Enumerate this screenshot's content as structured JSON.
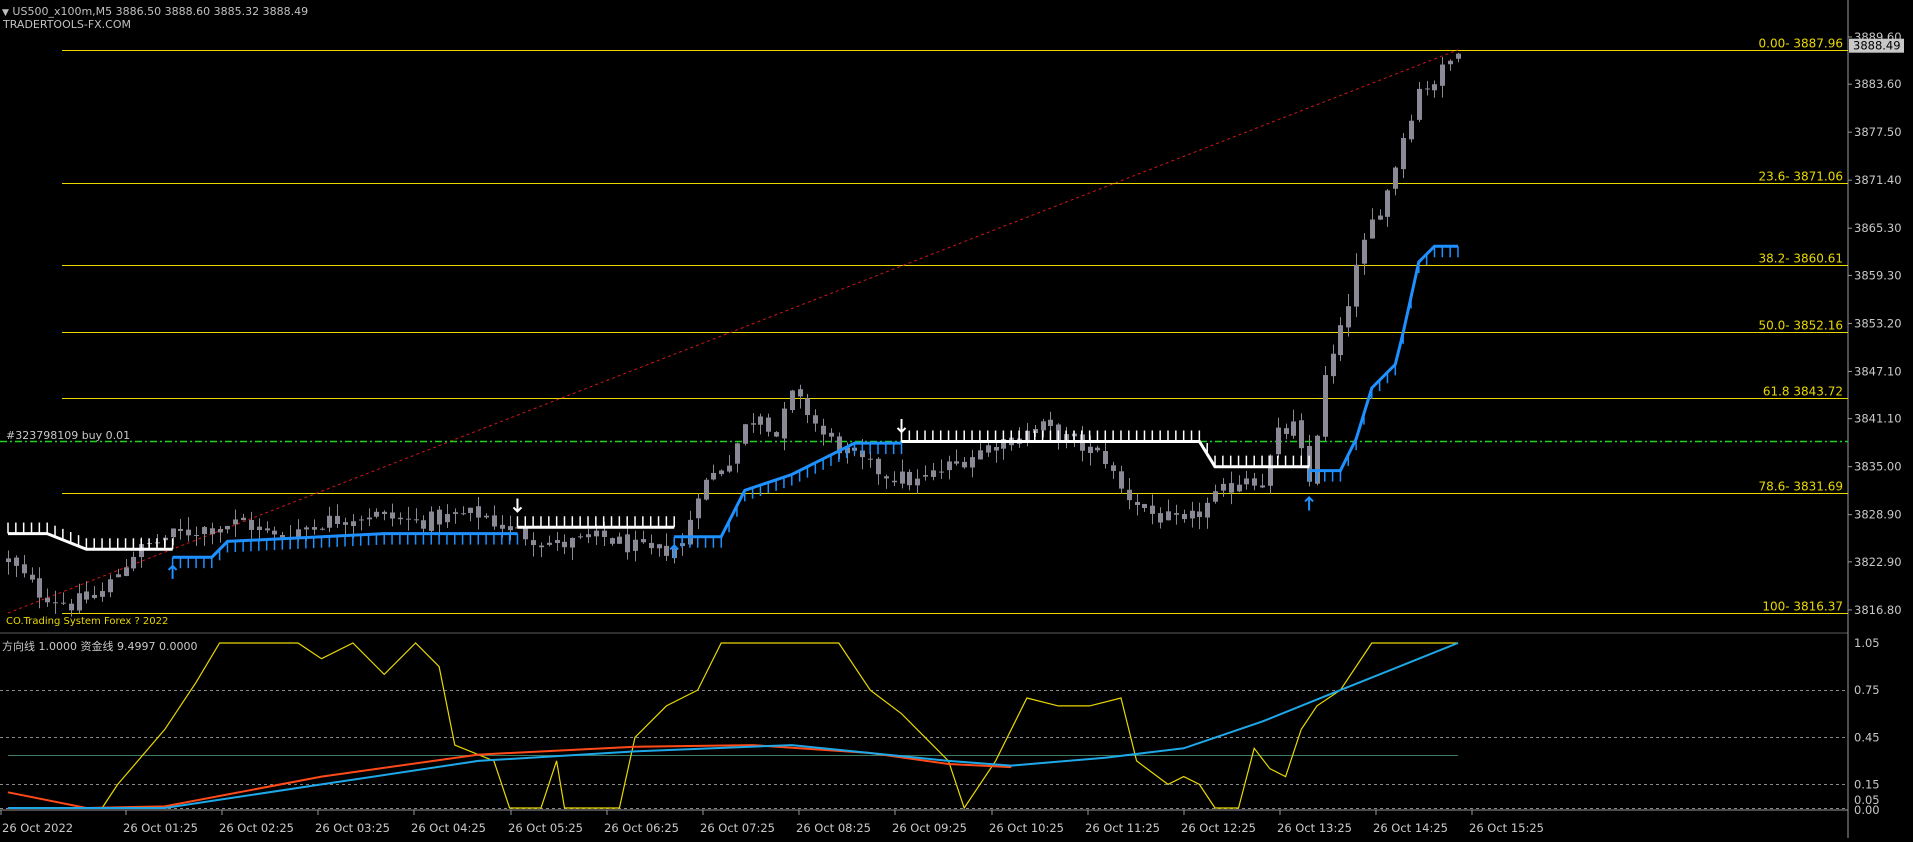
{
  "header": {
    "symbol_line": "US500_x100m,M5  3886.50 3888.60 3885.32 3888.49",
    "watermark": "TRADERTOOLS-FX.COM",
    "order_label": "#323798109 buy 0.01",
    "system_label": "CO.Trading System Forex  ? 2022",
    "indicator_label": "方向线 1.0000  资金线 9.4997 0.0000",
    "current_price": "3888.49"
  },
  "colors": {
    "background": "#000000",
    "candle": "#8a8a96",
    "fib": "#e8d800",
    "trend_line": "#d01818",
    "order_line": "#22d422",
    "stop_white": "#ffffff",
    "stop_blue": "#1e90ff",
    "direction_line": "#e8d800",
    "fund_line_blue": "#1ea8e8",
    "fund_line_red": "#ff4a1a",
    "price_badge": "#c8c8c8"
  },
  "chart_data": [
    {
      "type": "candlestick",
      "name_in_chart": "US500_x100m,M5",
      "ylim": [
        3814.5,
        3891.5
      ],
      "yticks": [
        "3889.60",
        "3883.60",
        "3877.50",
        "3871.40",
        "3865.30",
        "3859.30",
        "3853.20",
        "3847.10",
        "3841.10",
        "3835.00",
        "3828.90",
        "3822.90",
        "3816.80"
      ],
      "xticks": [
        "26 Oct 2022",
        "26 Oct 01:25",
        "26 Oct 02:25",
        "26 Oct 03:25",
        "26 Oct 04:25",
        "26 Oct 05:25",
        "26 Oct 06:25",
        "26 Oct 07:25",
        "26 Oct 08:25",
        "26 Oct 09:25",
        "26 Oct 10:25",
        "26 Oct 11:25",
        "26 Oct 12:25",
        "26 Oct 13:25",
        "26 Oct 14:25",
        "26 Oct 15:25"
      ],
      "fib_levels": [
        {
          "label": "0.00- 3887.96",
          "value": 3887.96
        },
        {
          "label": "23.6- 3871.06",
          "value": 3871.06
        },
        {
          "label": "38.2- 3860.61",
          "value": 3860.61
        },
        {
          "label": "50.0- 3852.16",
          "value": 3852.16
        },
        {
          "label": "61.8 3843.72",
          "value": 3843.72
        },
        {
          "label": "78.6- 3831.69",
          "value": 3831.69
        },
        {
          "label": "100- 3816.37",
          "value": 3816.37
        }
      ],
      "order_level": 3838.2,
      "trend_line": {
        "from": [
          0,
          3816.4
        ],
        "to": [
          185,
          3887.96
        ]
      },
      "price_anchors": [
        [
          0,
          3823
        ],
        [
          4,
          3819
        ],
        [
          8,
          3817.5
        ],
        [
          12,
          3819
        ],
        [
          16,
          3824
        ],
        [
          20,
          3826
        ],
        [
          24,
          3827
        ],
        [
          30,
          3828
        ],
        [
          34,
          3826
        ],
        [
          40,
          3828
        ],
        [
          46,
          3829
        ],
        [
          52,
          3828
        ],
        [
          56,
          3828.5
        ],
        [
          60,
          3829
        ],
        [
          64,
          3827
        ],
        [
          70,
          3825
        ],
        [
          76,
          3826
        ],
        [
          82,
          3824
        ],
        [
          86,
          3825
        ],
        [
          88,
          3832
        ],
        [
          92,
          3836
        ],
        [
          94,
          3840
        ],
        [
          96,
          3842
        ],
        [
          98,
          3839
        ],
        [
          100,
          3844
        ],
        [
          102,
          3842
        ],
        [
          104,
          3839
        ],
        [
          108,
          3836
        ],
        [
          112,
          3834
        ],
        [
          116,
          3833
        ],
        [
          120,
          3835
        ],
        [
          126,
          3838
        ],
        [
          132,
          3840
        ],
        [
          136,
          3838
        ],
        [
          140,
          3836
        ],
        [
          142,
          3832
        ],
        [
          146,
          3829
        ],
        [
          150,
          3827.5
        ],
        [
          154,
          3831
        ],
        [
          158,
          3834
        ],
        [
          160,
          3833
        ],
        [
          162,
          3839
        ],
        [
          164,
          3840
        ],
        [
          166,
          3833
        ],
        [
          168,
          3846
        ],
        [
          170,
          3852
        ],
        [
          172,
          3860
        ],
        [
          174,
          3866
        ],
        [
          176,
          3870
        ],
        [
          178,
          3877
        ],
        [
          180,
          3883
        ],
        [
          182,
          3884
        ],
        [
          184,
          3886.5
        ],
        [
          185,
          3888.5
        ]
      ],
      "stop_segments": [
        {
          "color": "white",
          "side": "above",
          "points": [
            [
              0,
              3826.5
            ],
            [
              5,
              3826.5
            ],
            [
              10,
              3824.5
            ],
            [
              21,
              3824.5
            ]
          ]
        },
        {
          "color": "blue",
          "side": "below",
          "points": [
            [
              21,
              3823.5
            ],
            [
              26,
              3823.5
            ],
            [
              28,
              3825.5
            ],
            [
              48,
              3826.5
            ],
            [
              65,
              3826.5
            ]
          ]
        },
        {
          "color": "white",
          "side": "above",
          "points": [
            [
              65,
              3827.3
            ],
            [
              85,
              3827.3
            ]
          ]
        },
        {
          "color": "blue",
          "side": "below",
          "points": [
            [
              85,
              3826.1
            ],
            [
              91,
              3826.1
            ],
            [
              94,
              3832
            ],
            [
              97,
              3833
            ],
            [
              100,
              3834
            ],
            [
              104,
              3836
            ],
            [
              108,
              3838
            ],
            [
              110,
              3838
            ],
            [
              114,
              3838
            ]
          ]
        },
        {
          "color": "white",
          "side": "above",
          "points": [
            [
              114,
              3838.2
            ],
            [
              152,
              3838.2
            ],
            [
              154,
              3835
            ],
            [
              166,
              3835
            ]
          ]
        },
        {
          "color": "blue",
          "side": "below",
          "points": [
            [
              166,
              3834.5
            ],
            [
              170,
              3834.5
            ],
            [
              172,
              3838.5
            ],
            [
              174,
              3845
            ],
            [
              177,
              3848
            ],
            [
              178,
              3852
            ],
            [
              180,
              3861
            ],
            [
              182,
              3863
            ],
            [
              185,
              3863
            ]
          ]
        }
      ],
      "arrows": [
        {
          "bar": 21,
          "value": 3821.5,
          "dir": "up",
          "color": "blue"
        },
        {
          "bar": 65,
          "value": 3830.2,
          "dir": "down",
          "color": "white"
        },
        {
          "bar": 85,
          "value": 3824.1,
          "dir": "up",
          "color": "blue"
        },
        {
          "bar": 114,
          "value": 3840.3,
          "dir": "down",
          "color": "white"
        },
        {
          "bar": 166,
          "value": 3830.2,
          "dir": "up",
          "color": "blue"
        }
      ]
    },
    {
      "type": "line",
      "name_in_chart": "方向线 / 资金线",
      "ylim": [
        0,
        1.05
      ],
      "yticks": [
        "1.05",
        "0.75",
        "0.45",
        "0.15",
        "0.05",
        "0.00"
      ],
      "series": [
        {
          "color": "yellow",
          "points": [
            [
              0,
              0
            ],
            [
              12,
              0
            ],
            [
              14,
              0.15
            ],
            [
              20,
              0.5
            ],
            [
              24,
              0.8
            ],
            [
              27,
              1.05
            ],
            [
              37,
              1.05
            ],
            [
              40,
              0.95
            ],
            [
              44,
              1.05
            ],
            [
              48,
              0.85
            ],
            [
              52,
              1.05
            ],
            [
              55,
              0.9
            ],
            [
              57,
              0.4
            ],
            [
              62,
              0.3
            ],
            [
              64,
              0
            ],
            [
              68,
              0
            ],
            [
              70,
              0.3
            ],
            [
              71,
              0
            ],
            [
              78,
              0
            ],
            [
              80,
              0.45
            ],
            [
              84,
              0.65
            ],
            [
              88,
              0.75
            ],
            [
              91,
              1.05
            ],
            [
              106,
              1.05
            ],
            [
              110,
              0.75
            ],
            [
              114,
              0.6
            ],
            [
              117,
              0.45
            ],
            [
              120,
              0.3
            ],
            [
              122,
              0
            ],
            [
              126,
              0.3
            ],
            [
              130,
              0.7
            ],
            [
              134,
              0.65
            ],
            [
              138,
              0.65
            ],
            [
              142,
              0.7
            ],
            [
              144,
              0.3
            ],
            [
              148,
              0.15
            ],
            [
              150,
              0.2
            ],
            [
              152,
              0.15
            ],
            [
              154,
              0
            ],
            [
              157,
              0
            ],
            [
              159,
              0.38
            ],
            [
              161,
              0.25
            ],
            [
              163,
              0.2
            ],
            [
              165,
              0.5
            ],
            [
              167,
              0.65
            ],
            [
              170,
              0.75
            ],
            [
              174,
              1.05
            ],
            [
              185,
              1.05
            ]
          ]
        },
        {
          "color": "red",
          "points": [
            [
              0,
              0.1
            ],
            [
              10,
              0
            ],
            [
              20,
              0.01
            ],
            [
              40,
              0.2
            ],
            [
              60,
              0.34
            ],
            [
              80,
              0.39
            ],
            [
              95,
              0.4
            ],
            [
              110,
              0.35
            ],
            [
              120,
              0.28
            ],
            [
              128,
              0.26
            ]
          ]
        },
        {
          "color": "blue",
          "points": [
            [
              0,
              0
            ],
            [
              20,
              0
            ],
            [
              40,
              0.15
            ],
            [
              60,
              0.3
            ],
            [
              80,
              0.36
            ],
            [
              100,
              0.4
            ],
            [
              120,
              0.3
            ],
            [
              128,
              0.27
            ],
            [
              140,
              0.32
            ],
            [
              150,
              0.38
            ],
            [
              160,
              0.55
            ],
            [
              170,
              0.75
            ],
            [
              180,
              0.95
            ],
            [
              185,
              1.05
            ]
          ]
        }
      ],
      "hlines": [
        0.75,
        0.45,
        0.15,
        0.0
      ],
      "solid_level": 0.34
    }
  ]
}
